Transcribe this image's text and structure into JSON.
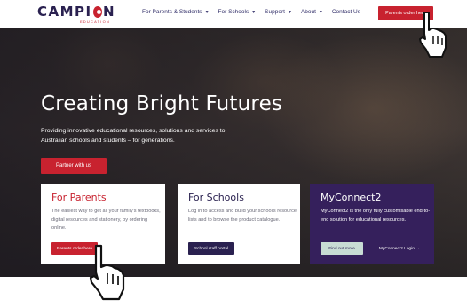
{
  "header": {
    "logo": {
      "text_left": "CAMPI",
      "text_right": "N",
      "subtitle": "EDUCATION"
    },
    "nav": [
      {
        "label": "For Parents & Students",
        "has_dropdown": true
      },
      {
        "label": "For Schools",
        "has_dropdown": true
      },
      {
        "label": "Support",
        "has_dropdown": true
      },
      {
        "label": "About",
        "has_dropdown": true
      },
      {
        "label": "Contact Us",
        "has_dropdown": false
      }
    ],
    "cta_label": "Parents order here"
  },
  "hero": {
    "title": "Creating Bright Futures",
    "description": "Providing innovative educational resources, solutions and services to Australian schools and students – for generations.",
    "button_label": "Partner with us"
  },
  "cards": {
    "parents": {
      "title": "For Parents",
      "description": "The easiest way to get all your family's textbooks, digital resources and stationery, by ordering online.",
      "button_label": "Parents order here"
    },
    "schools": {
      "title": "For Schools",
      "description": "Log in to access and build your school's resource lists and to browse the product catalogue.",
      "button_label": "School staff portal"
    },
    "myconnect": {
      "title": "MyConnect2",
      "description": "MyConnect2 is the only fully customisable end-to-end solution for educational resources.",
      "button_primary_label": "Find out more",
      "button_secondary_label": "MyConnect2 Login →"
    }
  },
  "colors": {
    "brand_red": "#c8222f",
    "brand_navy": "#2a2150",
    "myconnect_purple": "#35205c"
  },
  "icons": [
    "chevron-down-icon",
    "pointer-cursor-icon"
  ]
}
